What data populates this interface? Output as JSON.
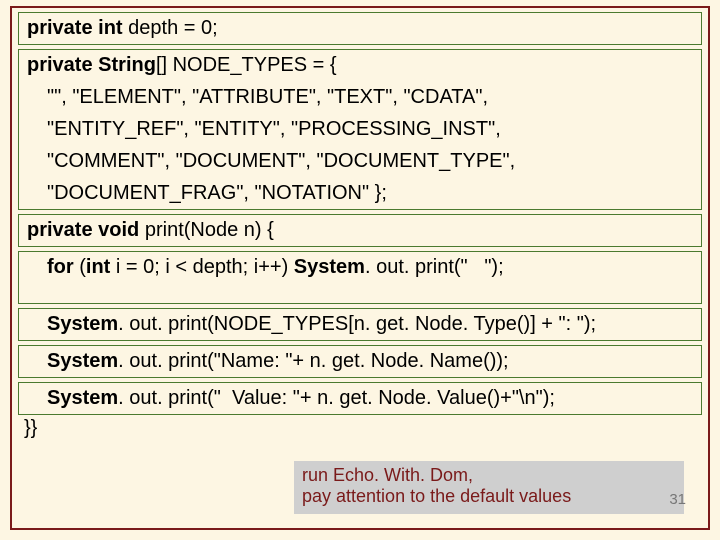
{
  "rows": {
    "r1": "private int depth = 0;",
    "r2a": "private String[] NODE_TYPES = {",
    "r2b": "\"\", \"ELEMENT\",   \"ATTRIBUTE\", \"TEXT\", \"CDATA\",",
    "r2c": "\"ENTITY_REF\", \"ENTITY\", \"PROCESSING_INST\",",
    "r2d": "\"COMMENT\", \"DOCUMENT\", \"DOCUMENT_TYPE\",",
    "r2e": "\"DOCUMENT_FRAG\", \"NOTATION\" };",
    "r3": "private void print(Node n) {",
    "r4a": "for (int i = 0; i < depth; i++) System. out. print(\"   \");",
    "r5": "System. out. print(NODE_TYPES[n. get. Node. Type()] + \": \");",
    "r6": "System. out. print(\"Name: \"+ n. get. Node. Name());",
    "r7": "System. out. print(\"  Value: \"+ n. get. Node. Value()+\"\\n\");"
  },
  "closing": "}}",
  "footnote_line1": "run Echo. With. Dom,",
  "footnote_line2": "pay attention to the default values",
  "page_number": "31",
  "kw": {
    "private": "private",
    "int": "int",
    "String": "String",
    "void": "void",
    "for": "for",
    "System": "System"
  }
}
